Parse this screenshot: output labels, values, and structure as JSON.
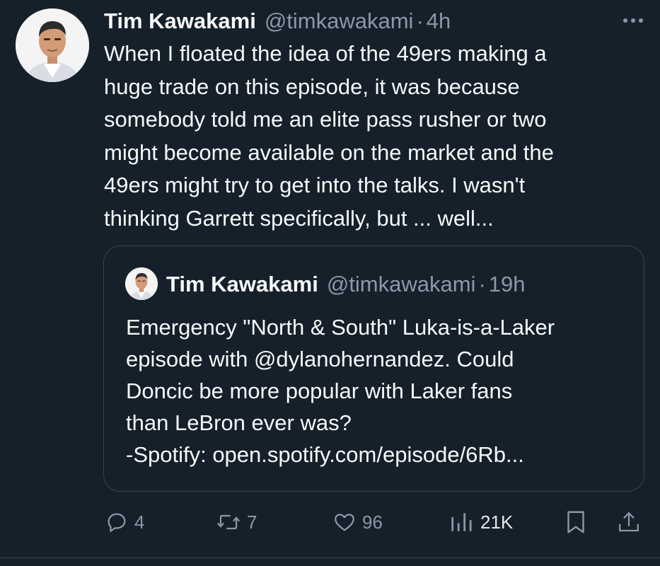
{
  "tweet": {
    "author_name": "Tim Kawakami",
    "author_handle": "@timkawakami",
    "separator": "·",
    "time": "4h",
    "text": "When I floated the idea of the 49ers making a\nhuge trade on this episode, it was because\nsomebody told me an elite pass rusher or two\nmight become available on the market and the\n49ers might try to get into the talks. I wasn't\nthinking Garrett specifically, but ... well..."
  },
  "quote": {
    "author_name": "Tim Kawakami",
    "author_handle": "@timkawakami",
    "separator": "·",
    "time": "19h",
    "text": "Emergency \"North & South\" Luka-is-a-Laker\nepisode with @dylanohernandez. Could\nDoncic be more popular with Laker fans\nthan LeBron ever was?\n-Spotify: open.spotify.com/episode/6Rb..."
  },
  "actions": {
    "replies": "4",
    "reposts": "7",
    "likes": "96",
    "views": "21K"
  },
  "icons": {
    "more": "more-icon",
    "reply": "reply-icon",
    "repost": "repost-icon",
    "like": "heart-icon",
    "views": "views-icon",
    "bookmark": "bookmark-icon",
    "share": "share-icon"
  },
  "colors": {
    "background": "#15202b",
    "text": "#f7f9f9",
    "secondary": "#8b98a5",
    "border": "#38444d"
  }
}
